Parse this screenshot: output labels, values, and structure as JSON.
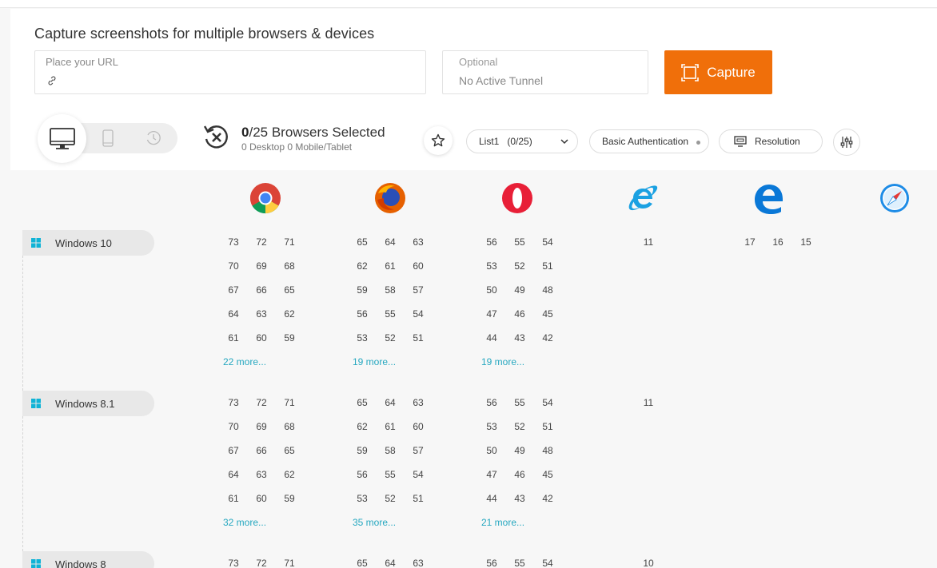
{
  "header": {
    "title": "Capture screenshots for multiple browsers & devices",
    "url_label": "Place your URL",
    "tunnel_label": "Optional",
    "tunnel_value": "No Active Tunnel",
    "capture_label": "Capture",
    "accent_color": "#f06f0a"
  },
  "selection": {
    "count": "0",
    "total": "/25 Browsers Selected",
    "sub": "0 Desktop 0 Mobile/Tablet"
  },
  "toolbar": {
    "list_label": "List1   (0/25)",
    "auth_label": "Basic Authentication",
    "resolution_label": "Resolution"
  },
  "browsers": [
    "chrome-icon",
    "firefox-icon",
    "opera-icon",
    "internet-explorer-icon",
    "edge-icon",
    "safari-icon"
  ],
  "os_groups": [
    {
      "name": "Windows 10",
      "chrome": [
        [
          "73",
          "72",
          "71"
        ],
        [
          "70",
          "69",
          "68"
        ],
        [
          "67",
          "66",
          "65"
        ],
        [
          "64",
          "63",
          "62"
        ],
        [
          "61",
          "60",
          "59"
        ]
      ],
      "chrome_more": "22 more...",
      "firefox": [
        [
          "65",
          "64",
          "63"
        ],
        [
          "62",
          "61",
          "60"
        ],
        [
          "59",
          "58",
          "57"
        ],
        [
          "56",
          "55",
          "54"
        ],
        [
          "53",
          "52",
          "51"
        ]
      ],
      "firefox_more": "19 more...",
      "opera": [
        [
          "56",
          "55",
          "54"
        ],
        [
          "53",
          "52",
          "51"
        ],
        [
          "50",
          "49",
          "48"
        ],
        [
          "47",
          "46",
          "45"
        ],
        [
          "44",
          "43",
          "42"
        ]
      ],
      "opera_more": "19 more...",
      "ie": [
        "11"
      ],
      "edge": [
        "17",
        "16",
        "15"
      ]
    },
    {
      "name": "Windows 8.1",
      "chrome": [
        [
          "73",
          "72",
          "71"
        ],
        [
          "70",
          "69",
          "68"
        ],
        [
          "67",
          "66",
          "65"
        ],
        [
          "64",
          "63",
          "62"
        ],
        [
          "61",
          "60",
          "59"
        ]
      ],
      "chrome_more": "32 more...",
      "firefox": [
        [
          "65",
          "64",
          "63"
        ],
        [
          "62",
          "61",
          "60"
        ],
        [
          "59",
          "58",
          "57"
        ],
        [
          "56",
          "55",
          "54"
        ],
        [
          "53",
          "52",
          "51"
        ]
      ],
      "firefox_more": "35 more...",
      "opera": [
        [
          "56",
          "55",
          "54"
        ],
        [
          "53",
          "52",
          "51"
        ],
        [
          "50",
          "49",
          "48"
        ],
        [
          "47",
          "46",
          "45"
        ],
        [
          "44",
          "43",
          "42"
        ]
      ],
      "opera_more": "21 more...",
      "ie": [
        "11"
      ],
      "edge": []
    },
    {
      "name": "Windows 8",
      "chrome": [
        [
          "73",
          "72",
          "71"
        ]
      ],
      "chrome_more": "",
      "firefox": [
        [
          "65",
          "64",
          "63"
        ]
      ],
      "firefox_more": "",
      "opera": [
        [
          "56",
          "55",
          "54"
        ]
      ],
      "opera_more": "",
      "ie": [
        "10"
      ],
      "edge": []
    }
  ]
}
